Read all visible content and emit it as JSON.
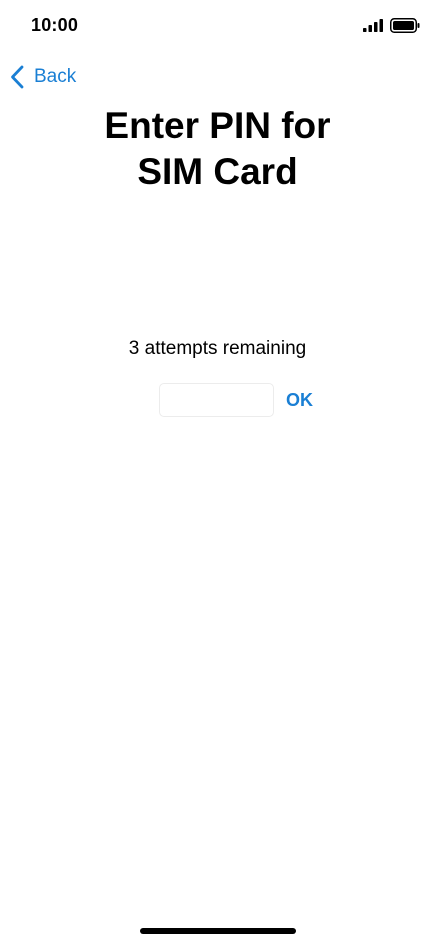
{
  "status_bar": {
    "time": "10:00",
    "signal_icon": "cellular-signal-icon",
    "battery_icon": "battery-full-icon"
  },
  "nav": {
    "back_label": "Back",
    "back_icon": "chevron-left-icon"
  },
  "title": {
    "line1": "Enter PIN for",
    "line2": "SIM Card"
  },
  "pin_entry": {
    "attempts_text": "3 attempts remaining",
    "input_value": "",
    "ok_label": "OK"
  },
  "colors": {
    "accent": "#1a7fd4",
    "text": "#000000",
    "background": "#ffffff"
  }
}
